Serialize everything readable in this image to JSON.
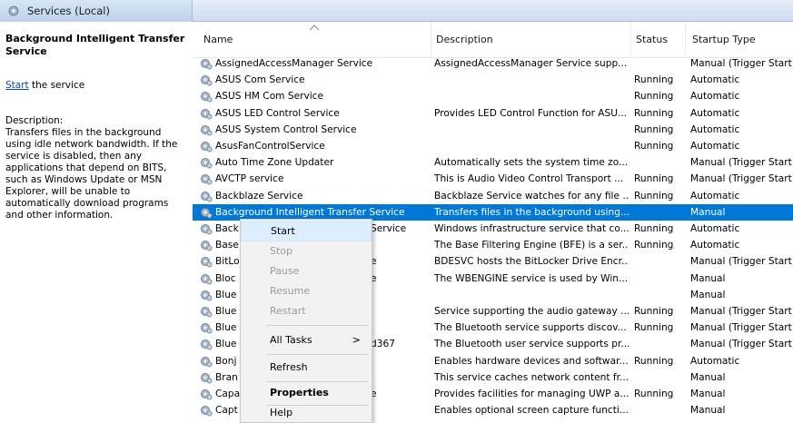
{
  "header": {
    "tab_title": "Services (Local)"
  },
  "left_pane": {
    "service_title": "Background Intelligent Transfer Service",
    "start_link": "Start",
    "start_suffix": " the service",
    "description_label": "Description:",
    "description_text": "Transfers files in the background using idle network bandwidth. If the service is disabled, then any applications that depend on BITS, such as Windows Update or MSN Explorer, will be unable to automatically download programs and other information."
  },
  "columns": {
    "name": "Name",
    "description": "Description",
    "status": "Status",
    "startup_type": "Startup Type"
  },
  "rows": [
    {
      "name": "AssignedAccessManager Service",
      "description": "AssignedAccessManager Service supp...",
      "status": "",
      "startup": "Manual (Trigger Start)"
    },
    {
      "name": "ASUS Com Service",
      "description": "",
      "status": "Running",
      "startup": "Automatic"
    },
    {
      "name": "ASUS HM Com Service",
      "description": "",
      "status": "Running",
      "startup": "Automatic"
    },
    {
      "name": "ASUS LED Control Service",
      "description": "Provides LED Control Function for ASU...",
      "status": "Running",
      "startup": "Automatic"
    },
    {
      "name": "ASUS System Control Service",
      "description": "",
      "status": "Running",
      "startup": "Automatic"
    },
    {
      "name": "AsusFanControlService",
      "description": "",
      "status": "Running",
      "startup": "Automatic"
    },
    {
      "name": "Auto Time Zone Updater",
      "description": "Automatically sets the system time zo...",
      "status": "",
      "startup": "Manual (Trigger Start)"
    },
    {
      "name": "AVCTP service",
      "description": "This is Audio Video Control Transport ...",
      "status": "Running",
      "startup": "Manual (Trigger Start)"
    },
    {
      "name": "Backblaze Service",
      "description": "Backblaze Service watches for any file ...",
      "status": "Running",
      "startup": "Automatic"
    },
    {
      "name": "Background Intelligent Transfer Service",
      "description": "Transfers files in the background using...",
      "status": "",
      "startup": "Manual"
    },
    {
      "name": "Back",
      "name_right": "Service",
      "description": "Windows infrastructure service that co...",
      "status": "Running",
      "startup": "Automatic"
    },
    {
      "name": "Base",
      "name_right": "",
      "description": "The Base Filtering Engine (BFE) is a ser...",
      "status": "Running",
      "startup": "Automatic"
    },
    {
      "name": "BitLo",
      "name_right": "e",
      "description": "BDESVC hosts the BitLocker Drive Encr...",
      "status": "",
      "startup": "Manual (Trigger Start)"
    },
    {
      "name": "Bloc",
      "name_right": "e",
      "description": "The WBENGINE service is used by Win...",
      "status": "",
      "startup": "Manual"
    },
    {
      "name": "Blue",
      "name_right": "",
      "description": "",
      "status": "",
      "startup": "Manual"
    },
    {
      "name": "Blue",
      "name_right": "",
      "description": "Service supporting the audio gateway ...",
      "status": "Running",
      "startup": "Manual (Trigger Start)"
    },
    {
      "name": "Blue",
      "name_right": "",
      "description": "The Bluetooth service supports discov...",
      "status": "Running",
      "startup": "Manual (Trigger Start)"
    },
    {
      "name": "Blue",
      "name_right": "d367",
      "description": "The Bluetooth user service supports pr...",
      "status": "",
      "startup": "Manual (Trigger Start)"
    },
    {
      "name": "Bonj",
      "name_right": "",
      "description": "Enables hardware devices and softwar...",
      "status": "Running",
      "startup": "Automatic"
    },
    {
      "name": "Bran",
      "name_right": "",
      "description": "This service caches network content fr...",
      "status": "",
      "startup": "Manual"
    },
    {
      "name": "Capa",
      "name_right": "e",
      "description": "Provides facilities for managing UWP a...",
      "status": "Running",
      "startup": "Manual"
    },
    {
      "name": "Capt",
      "name_right": "",
      "description": "Enables optional screen capture functi...",
      "status": "",
      "startup": "Manual"
    }
  ],
  "context_menu": {
    "start": "Start",
    "stop": "Stop",
    "pause": "Pause",
    "resume": "Resume",
    "restart": "Restart",
    "all_tasks": "All Tasks",
    "all_tasks_arrow": ">",
    "refresh": "Refresh",
    "properties": "Properties",
    "help": "Help"
  }
}
